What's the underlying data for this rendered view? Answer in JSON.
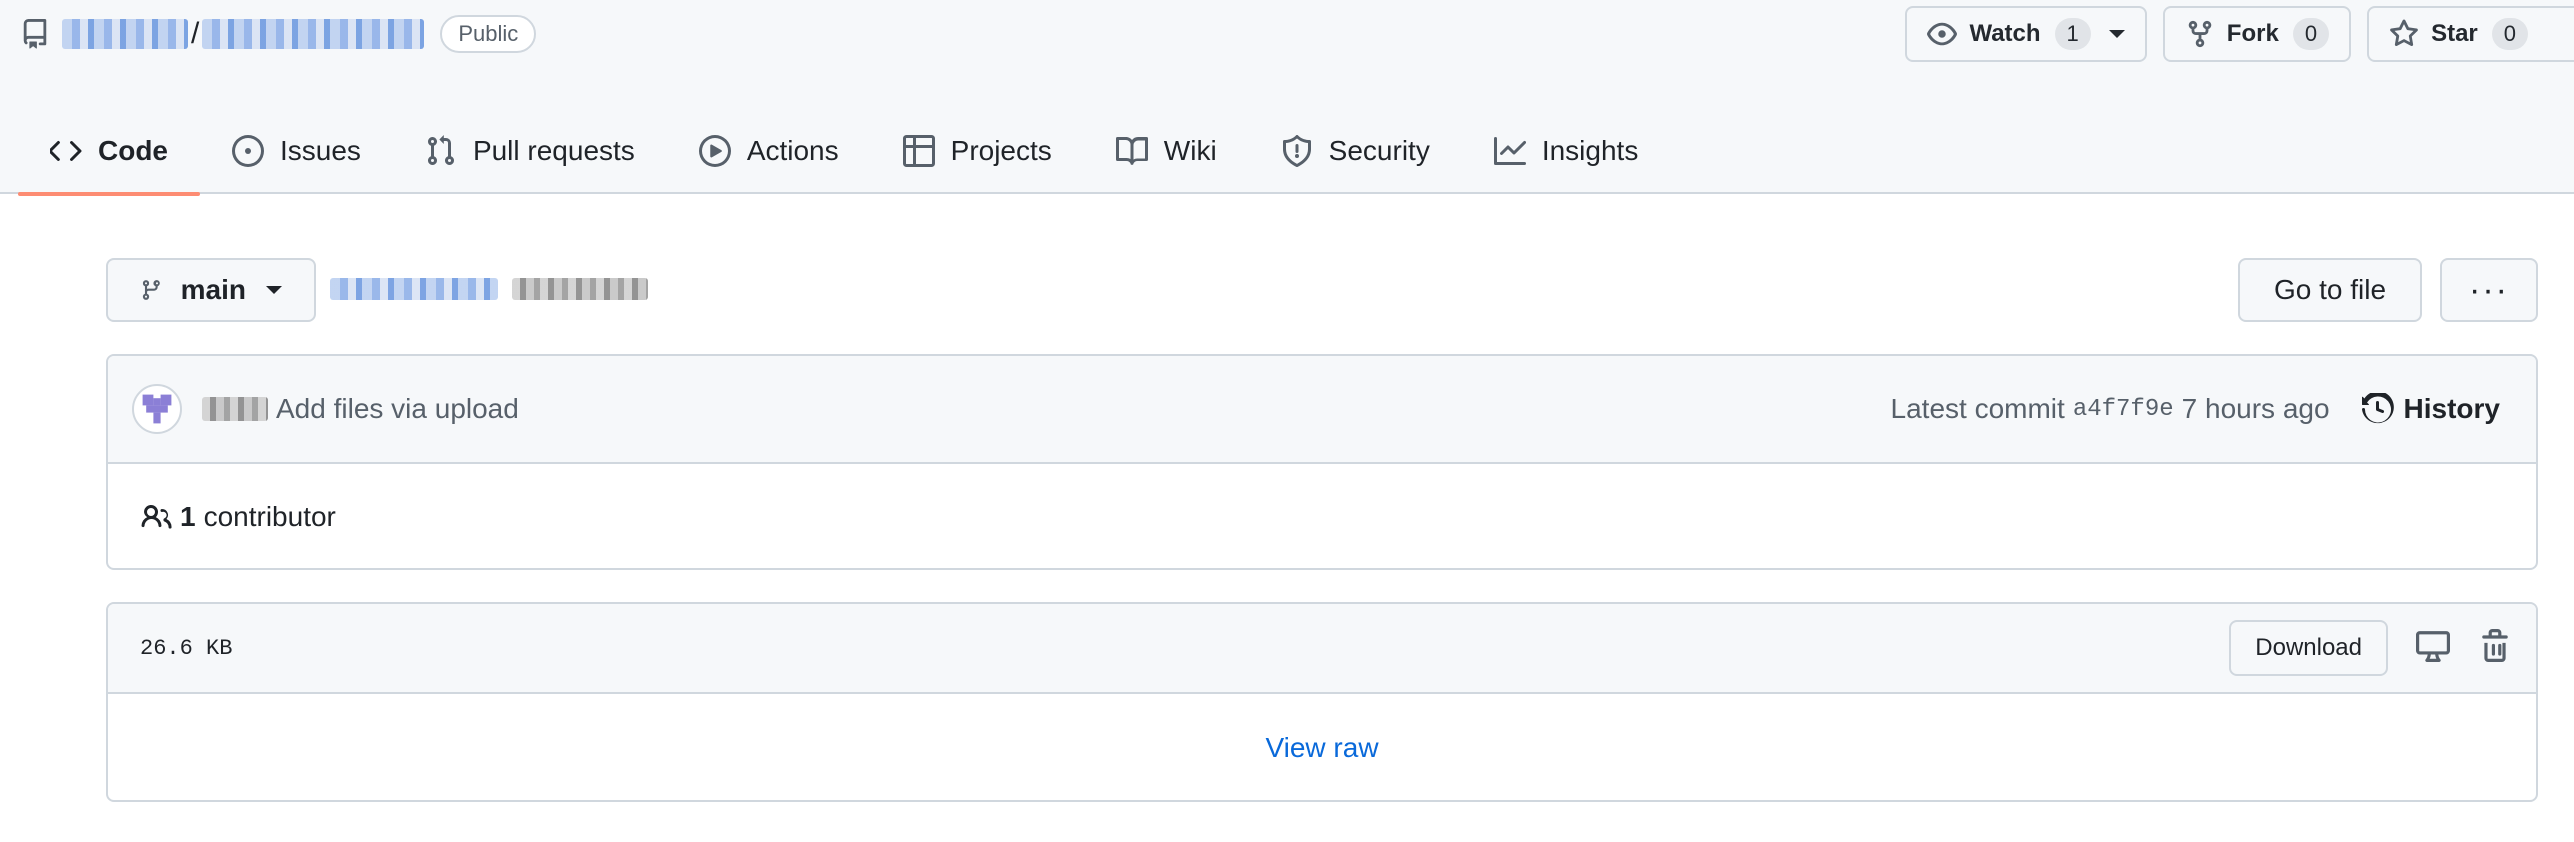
{
  "repo": {
    "visibility_badge": "Public",
    "separator": "/"
  },
  "actions": {
    "watch_label": "Watch",
    "watch_count": "1",
    "fork_label": "Fork",
    "fork_count": "0",
    "star_label": "Star",
    "star_count": "0"
  },
  "tabs": [
    {
      "label": "Code",
      "icon": "code-icon",
      "active": true
    },
    {
      "label": "Issues",
      "icon": "issue-opened-icon"
    },
    {
      "label": "Pull requests",
      "icon": "git-pull-request-icon"
    },
    {
      "label": "Actions",
      "icon": "play-icon"
    },
    {
      "label": "Projects",
      "icon": "table-icon"
    },
    {
      "label": "Wiki",
      "icon": "book-icon"
    },
    {
      "label": "Security",
      "icon": "shield-icon"
    },
    {
      "label": "Insights",
      "icon": "graph-icon"
    }
  ],
  "branch": {
    "name": "main"
  },
  "toolbar": {
    "goto_file_label": "Go to file",
    "more_label": "···"
  },
  "commit": {
    "message": "Add files via upload",
    "latest_label": "Latest commit",
    "sha": "a4f7f9e",
    "time": "7 hours ago",
    "history_label": "History"
  },
  "contributors": {
    "count": "1",
    "label": "contributor"
  },
  "file": {
    "size": "26.6 KB",
    "download_label": "Download",
    "view_raw_label": "View raw"
  },
  "colors": {
    "accent_tab_underline": "#fd8c73",
    "link": "#0969da",
    "border": "#d0d7de"
  }
}
